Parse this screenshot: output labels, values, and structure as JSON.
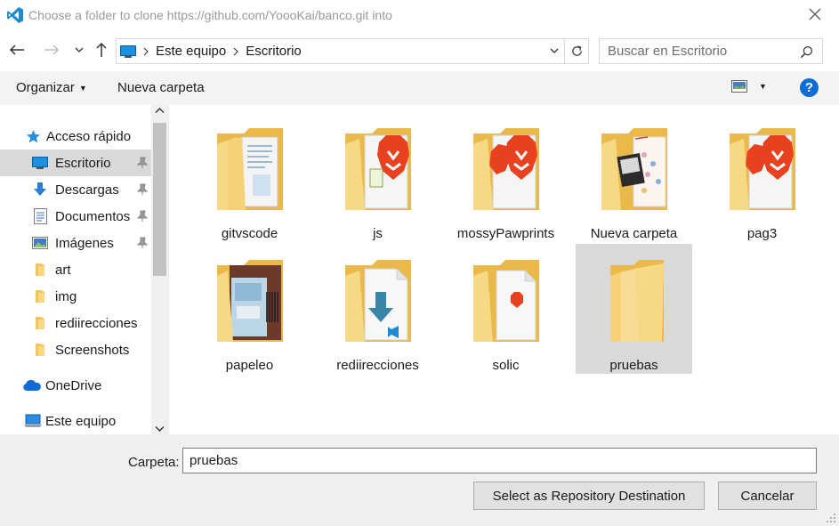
{
  "window": {
    "title": "Choose a folder to clone https://github.com/YoooKai/banco.git into",
    "app_icon": "vscode-icon",
    "close_icon": "close-icon"
  },
  "address_bar": {
    "breadcrumbs": [
      "Este equipo",
      "Escritorio"
    ],
    "root_icon": "computer-icon"
  },
  "search": {
    "placeholder": "Buscar en Escritorio"
  },
  "toolbar": {
    "organize_label": "Organizar",
    "new_folder_label": "Nueva carpeta",
    "help_label": "?"
  },
  "sidebar": {
    "items": [
      {
        "label": "Acceso rápido",
        "icon": "star-icon",
        "pinned": false
      },
      {
        "label": "Escritorio",
        "icon": "desktop-icon",
        "pinned": true,
        "selected": true
      },
      {
        "label": "Descargas",
        "icon": "download-icon",
        "pinned": true
      },
      {
        "label": "Documentos",
        "icon": "document-icon",
        "pinned": true
      },
      {
        "label": "Imágenes",
        "icon": "image-icon",
        "pinned": true
      },
      {
        "label": "art",
        "icon": "folder-icon",
        "pinned": false
      },
      {
        "label": "img",
        "icon": "folder-icon",
        "pinned": false
      },
      {
        "label": "rediirecciones",
        "icon": "folder-icon",
        "pinned": false
      },
      {
        "label": "Screenshots",
        "icon": "folder-icon",
        "pinned": false
      },
      {
        "label": "OneDrive",
        "icon": "cloud-icon",
        "pinned": false
      },
      {
        "label": "Este equipo",
        "icon": "computer-icon",
        "pinned": false
      }
    ]
  },
  "folders": [
    {
      "label": "gitvscode",
      "preview": "documents"
    },
    {
      "label": "js",
      "preview": "brave"
    },
    {
      "label": "mossyPawprints",
      "preview": "brave"
    },
    {
      "label": "Nueva carpeta",
      "preview": "images"
    },
    {
      "label": "pag3",
      "preview": "brave"
    },
    {
      "label": "papeleo",
      "preview": "cards"
    },
    {
      "label": "rediirecciones",
      "preview": "vscode-file"
    },
    {
      "label": "solic",
      "preview": "pdf"
    },
    {
      "label": "pruebas",
      "preview": "empty",
      "selected": true
    }
  ],
  "footer": {
    "folder_label": "Carpeta:",
    "folder_value": "pruebas",
    "select_button": "Select as Repository Destination",
    "cancel_button": "Cancelar"
  },
  "colors": {
    "accent": "#0f6cd4",
    "folder": "#f5d27a",
    "selection": "#d9d9d9",
    "brave": "#e8411f"
  }
}
